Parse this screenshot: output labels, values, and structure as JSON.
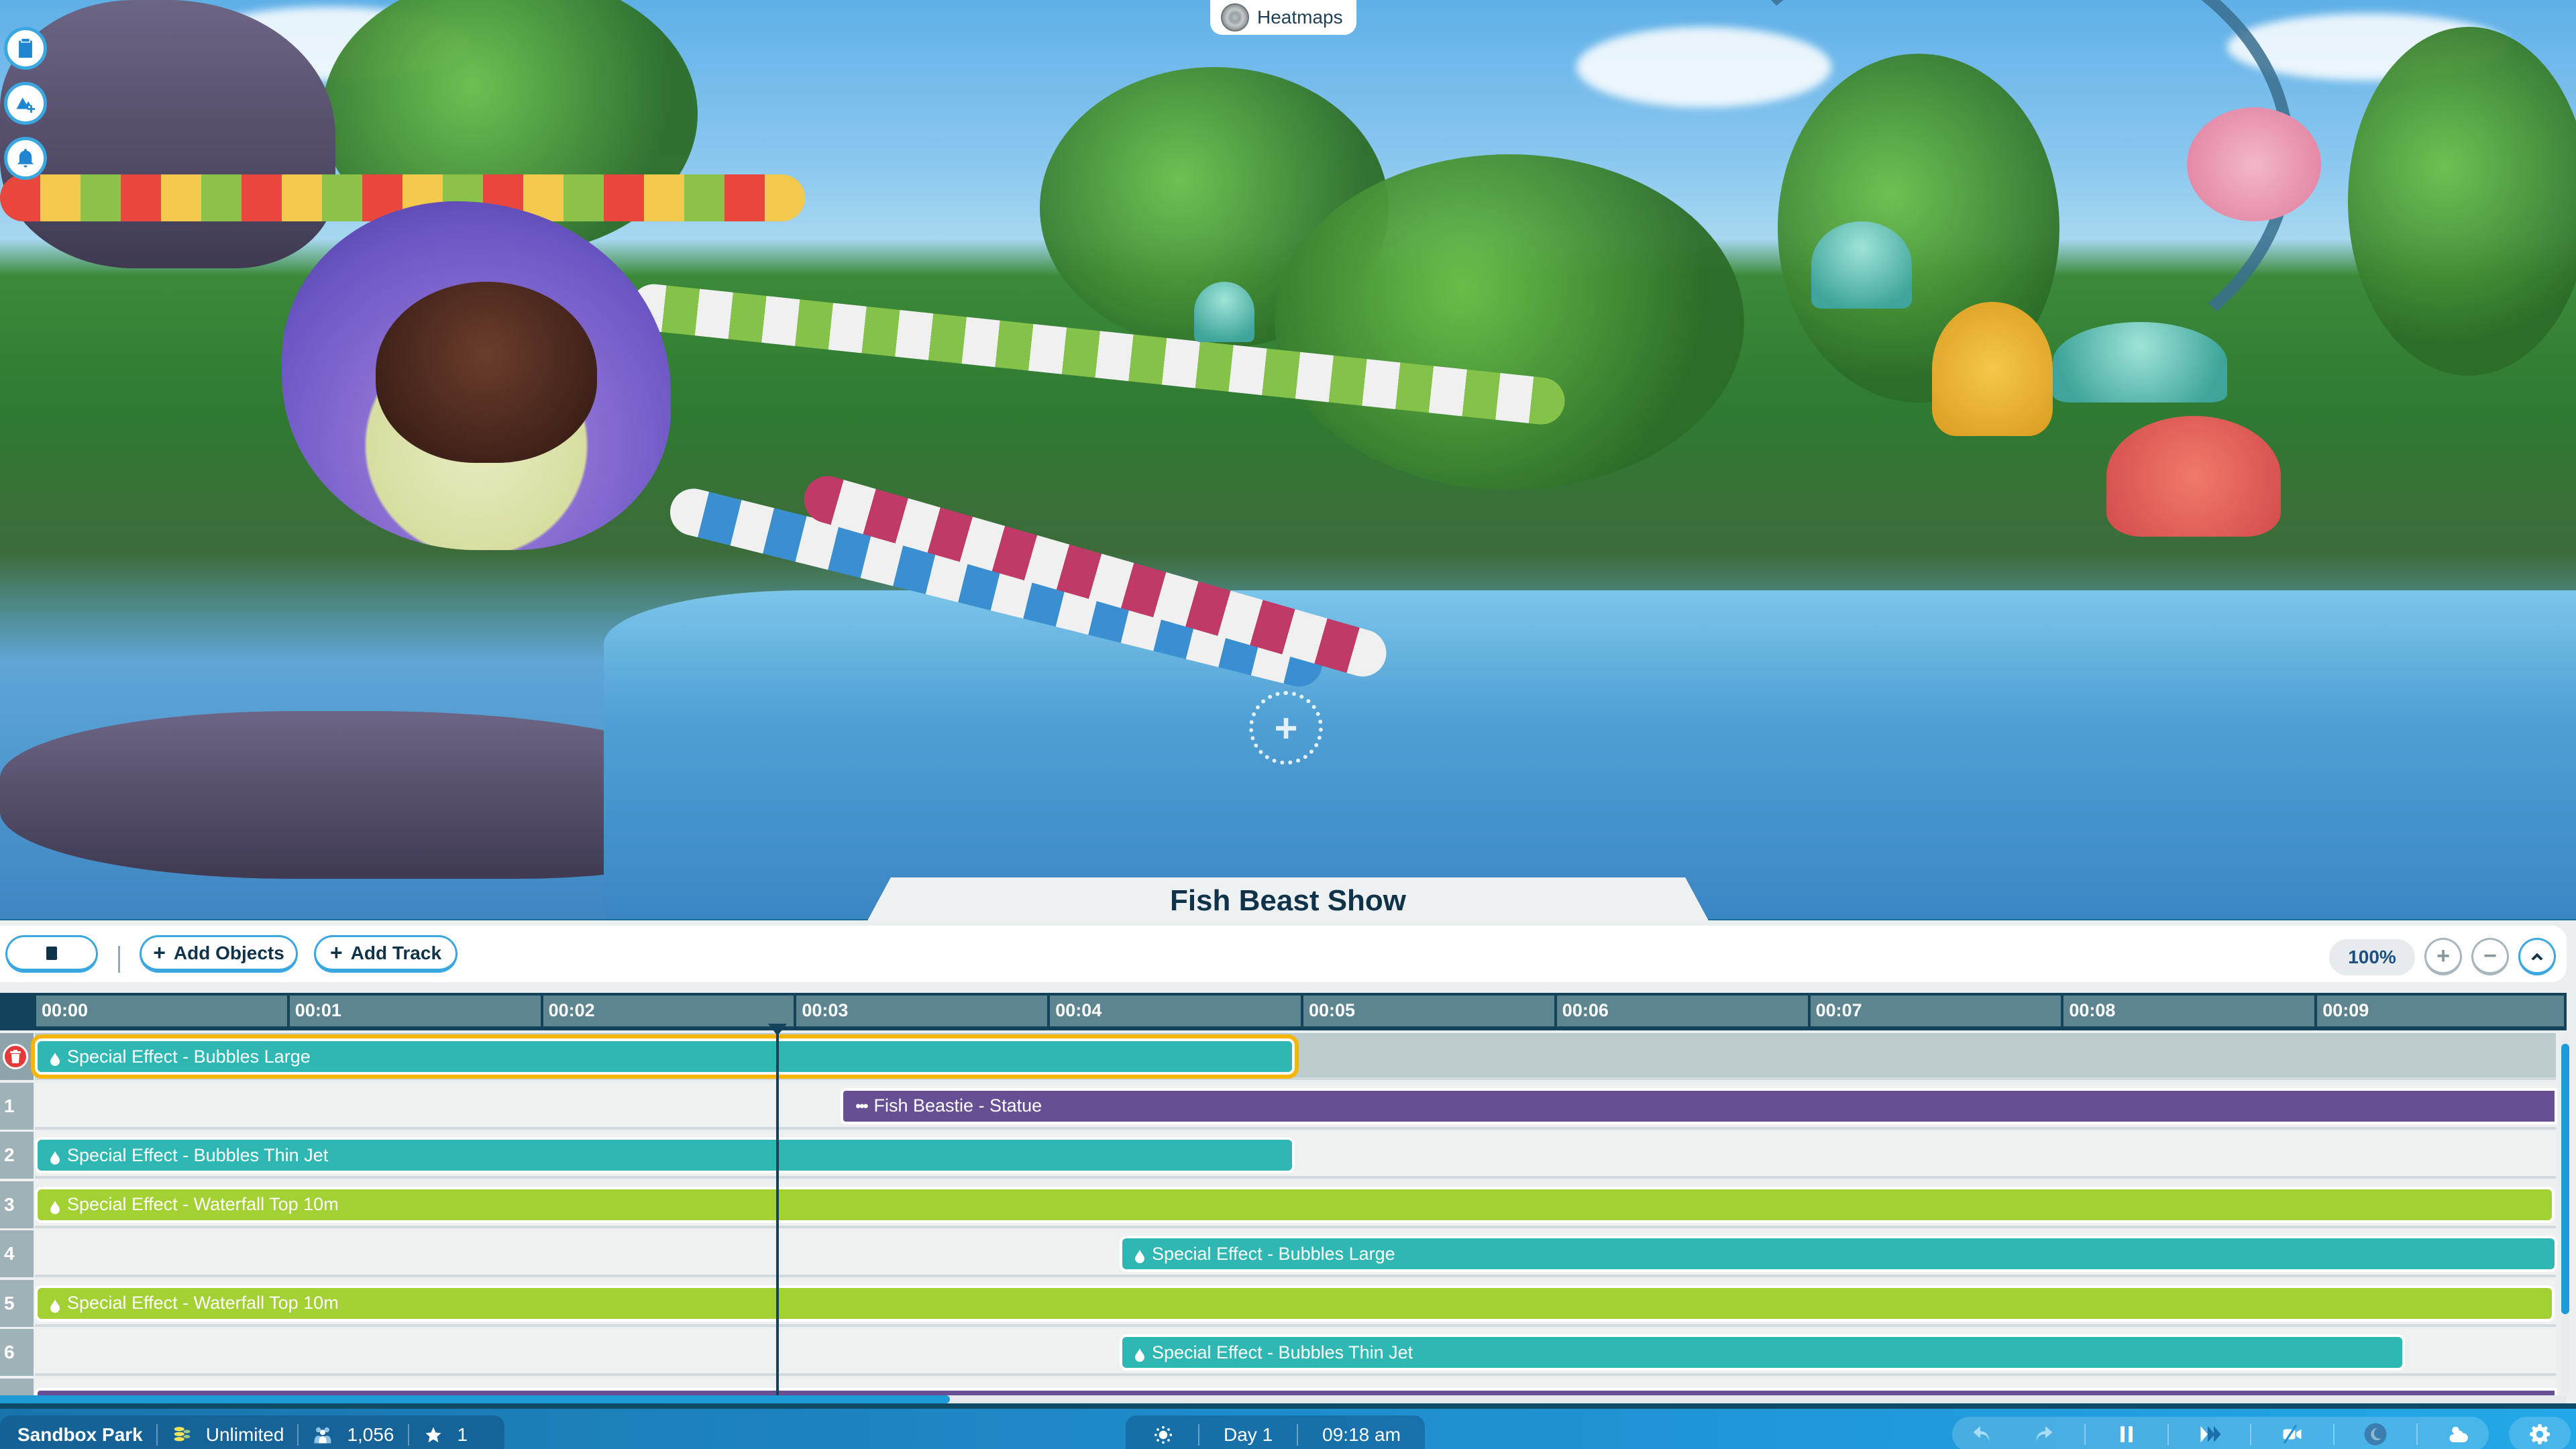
{
  "scene": {
    "description": "Water park with fish statue, slides and pool",
    "hud_buttons": [
      {
        "name": "clipboard-icon"
      },
      {
        "name": "terrain-add-icon"
      },
      {
        "name": "bell-icon"
      }
    ],
    "heatmaps_label": "Heatmaps",
    "cursor_symbol": "+"
  },
  "editor": {
    "title": "Fish Beast Show",
    "toolbar": {
      "stop_label": "",
      "add_objects_label": "Add Objects",
      "add_track_label": "Add Track",
      "plus_symbol": "+",
      "zoom_level": "100%",
      "zoom_in_symbol": "+",
      "zoom_out_symbol": "−",
      "collapse_symbol": "^"
    },
    "timeline": {
      "ticks": [
        "00:00",
        "00:01",
        "00:02",
        "00:03",
        "00:04",
        "00:05",
        "00:06",
        "00:07",
        "00:08",
        "00:09"
      ],
      "playhead_seconds": 2.92,
      "visible_seconds": 10,
      "tracks": [
        {
          "number": "",
          "selected": true,
          "delete": true,
          "clips": [
            {
              "label": "Special Effect - Bubbles Large",
              "color": "teal",
              "icon": "drop",
              "start": 0.0,
              "end": 4.96,
              "selected": true
            }
          ]
        },
        {
          "number": "1",
          "clips": [
            {
              "label": "Fish Beastie - Statue",
              "color": "purple",
              "icon": "dots",
              "start": 3.18,
              "end": 10.0
            }
          ]
        },
        {
          "number": "2",
          "clips": [
            {
              "label": "Special Effect - Bubbles Thin Jet",
              "color": "teal",
              "icon": "drop",
              "start": 0.0,
              "end": 4.96
            }
          ]
        },
        {
          "number": "3",
          "clips": [
            {
              "label": "Special Effect - Waterfall Top 10m",
              "color": "lime",
              "icon": "drop",
              "start": 0.0,
              "end": 9.93
            }
          ]
        },
        {
          "number": "4",
          "clips": [
            {
              "label": "Special Effect - Bubbles Large",
              "color": "teal",
              "icon": "drop",
              "start": 4.28,
              "end": 10.0
            }
          ]
        },
        {
          "number": "5",
          "clips": [
            {
              "label": "Special Effect - Waterfall Top 10m",
              "color": "lime",
              "icon": "drop",
              "start": 0.0,
              "end": 9.93
            }
          ]
        },
        {
          "number": "6",
          "clips": [
            {
              "label": "Special Effect - Bubbles Thin Jet",
              "color": "teal",
              "icon": "drop",
              "start": 4.28,
              "end": 9.34
            }
          ]
        },
        {
          "number": "",
          "clips": [
            {
              "label": "",
              "color": "purple",
              "icon": "",
              "start": 0.0,
              "end": 10.0
            }
          ]
        }
      ],
      "vertical_scroll_fraction": 0.76,
      "horizontal_scroll_fraction": 0.37
    },
    "colors": {
      "teal": "#2fb8b3",
      "lime": "#a3d133",
      "purple": "#665093",
      "selection": "#f7b500",
      "header": "#5d8590",
      "accent": "#1e9ad6"
    }
  },
  "statusbar": {
    "park_name": "Sandbox Park",
    "money": "Unlimited",
    "guests": "1,056",
    "rating": "1",
    "day": "Day 1",
    "time": "09:18 am",
    "controls": [
      "undo-icon",
      "redo-icon",
      "pause-icon",
      "fast-forward-icon",
      "camera-off-icon",
      "day-night-icon",
      "weather-icon"
    ],
    "settings": "gear-icon"
  }
}
